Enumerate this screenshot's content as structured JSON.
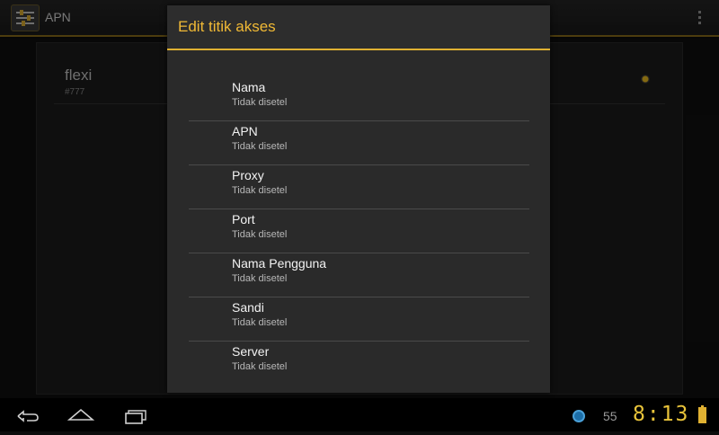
{
  "action_bar": {
    "title": "APN",
    "app_icon": "settings-sliders-icon",
    "overflow_icon": "overflow-menu-icon"
  },
  "apn_list": {
    "items": [
      {
        "name": "flexi",
        "number": "#777",
        "selected": true
      }
    ]
  },
  "dialog": {
    "title": "Edit titik akses",
    "items": [
      {
        "title": "Nama",
        "value": "Tidak disetel"
      },
      {
        "title": "APN",
        "value": "Tidak disetel"
      },
      {
        "title": "Proxy",
        "value": "Tidak disetel"
      },
      {
        "title": "Port",
        "value": "Tidak disetel"
      },
      {
        "title": "Nama Pengguna",
        "value": "Tidak disetel"
      },
      {
        "title": "Sandi",
        "value": "Tidak disetel"
      },
      {
        "title": "Server",
        "value": "Tidak disetel"
      }
    ]
  },
  "system_bar": {
    "back_icon": "back-icon",
    "home_icon": "home-icon",
    "recent_icon": "recent-apps-icon",
    "notification_count": "55",
    "time": "8:13",
    "battery_icon": "battery-icon",
    "vpn_icon": "vpn-status-icon"
  },
  "colors": {
    "accent": "#e0b132",
    "dialog_bg": "#2a2a2a",
    "background": "#0c0c0c"
  }
}
